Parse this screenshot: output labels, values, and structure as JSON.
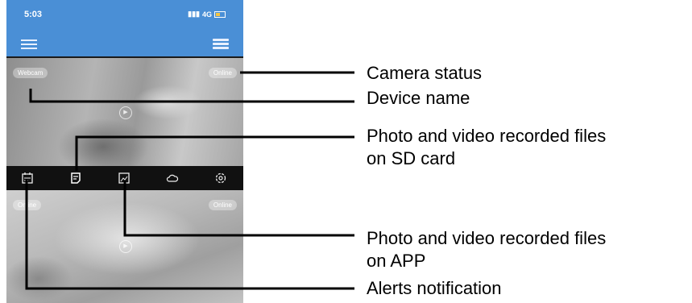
{
  "status_bar": {
    "time": "5:03",
    "network": "4G"
  },
  "cameras": [
    {
      "name": "Webcam",
      "status": "Online"
    },
    {
      "name": "Online",
      "status": "Online"
    }
  ],
  "toolbar_icons": [
    "calendar-alert-icon",
    "sd-card-files-icon",
    "app-gallery-icon",
    "cloud-icon",
    "settings-icon"
  ],
  "callouts": {
    "camera_status": "Camera status",
    "device_name": "Device name",
    "sd_card_line1": "Photo and video recorded files",
    "sd_card_line2": "on SD card",
    "app_line1": "Photo and video recorded files",
    "app_line2": "on APP",
    "alerts": "Alerts notification"
  },
  "colors": {
    "app_bar": "#4a8fd6",
    "toolbar": "#111111"
  }
}
